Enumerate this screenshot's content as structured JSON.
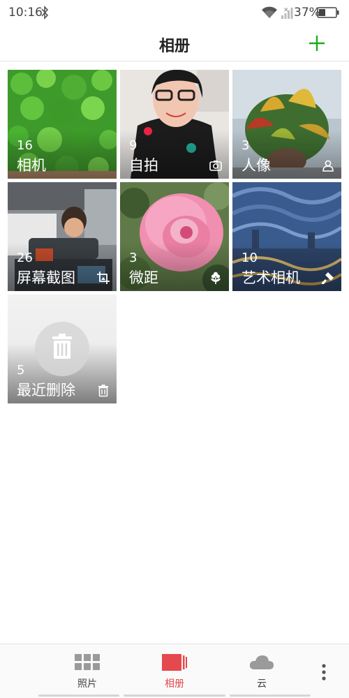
{
  "status_bar": {
    "time": "10:16",
    "battery_percent": "37%",
    "icons": [
      "bluetooth-icon",
      "wifi-icon",
      "signal-icon",
      "battery-icon"
    ]
  },
  "header": {
    "title": "相册",
    "add_icon": "plus-icon",
    "accent_color": "#1aad19"
  },
  "albums": [
    {
      "count": "16",
      "name": "相机",
      "badge_icon": ""
    },
    {
      "count": "9",
      "name": "自拍",
      "badge_icon": "camera-flip-icon"
    },
    {
      "count": "3",
      "name": "人像",
      "badge_icon": "portrait-icon"
    },
    {
      "count": "26",
      "name": "屏幕截图",
      "badge_icon": "screenshot-crop-icon"
    },
    {
      "count": "3",
      "name": "微距",
      "badge_icon": "macro-flower-icon"
    },
    {
      "count": "10",
      "name": "艺术相机",
      "badge_icon": "brush-icon"
    },
    {
      "count": "5",
      "name": "最近删除",
      "badge_icon": "trash-icon"
    }
  ],
  "bottom_nav": {
    "items": [
      {
        "label": "照片",
        "icon": "grid-icon"
      },
      {
        "label": "相册",
        "icon": "album-icon",
        "active": true
      },
      {
        "label": "云",
        "icon": "cloud-icon"
      }
    ],
    "more_icon": "more-vertical-icon",
    "active_color": "#e5484d"
  }
}
